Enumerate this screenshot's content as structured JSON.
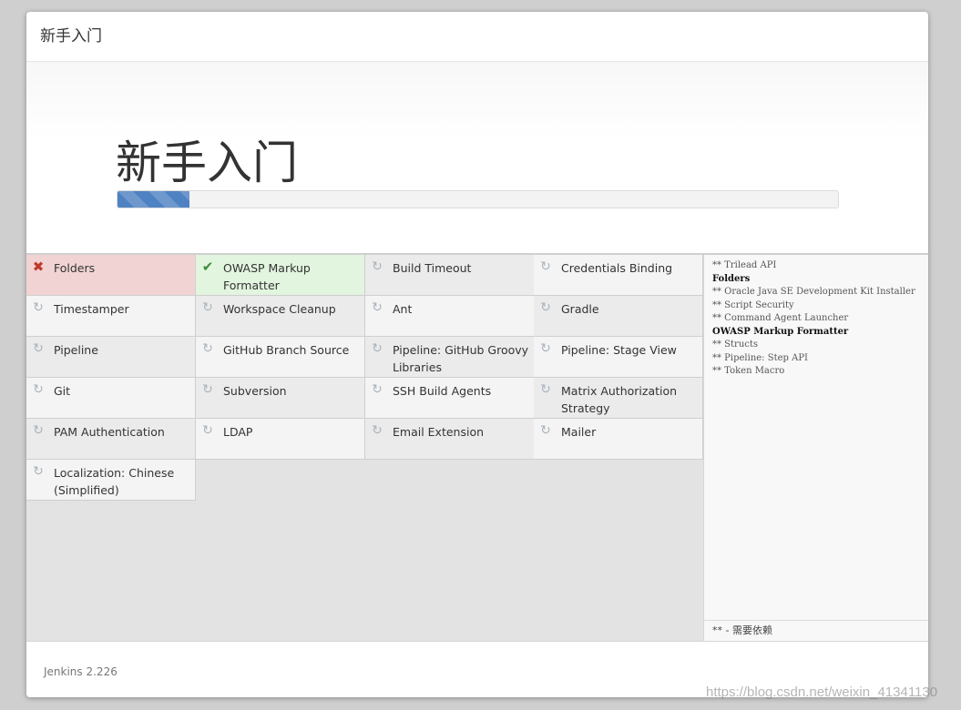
{
  "header": {
    "title": "新手入门"
  },
  "jumbotron": {
    "title": "新手入门",
    "progress_fraction": 0.1
  },
  "plugins": [
    {
      "name": "Folders",
      "status": "failed",
      "icon": "x-icon"
    },
    {
      "name": "OWASP Markup Formatter",
      "status": "success",
      "icon": "check-icon"
    },
    {
      "name": "Build Timeout",
      "status": "pending",
      "icon": "refresh-icon"
    },
    {
      "name": "Credentials Binding",
      "status": "pending",
      "icon": "refresh-icon"
    },
    {
      "name": "Timestamper",
      "status": "pending",
      "icon": "refresh-icon"
    },
    {
      "name": "Workspace Cleanup",
      "status": "pending",
      "icon": "refresh-icon"
    },
    {
      "name": "Ant",
      "status": "pending",
      "icon": "refresh-icon"
    },
    {
      "name": "Gradle",
      "status": "pending",
      "icon": "refresh-icon"
    },
    {
      "name": "Pipeline",
      "status": "pending",
      "icon": "refresh-icon"
    },
    {
      "name": "GitHub Branch Source",
      "status": "pending",
      "icon": "refresh-icon"
    },
    {
      "name": "Pipeline: GitHub Groovy Libraries",
      "status": "pending",
      "icon": "refresh-icon"
    },
    {
      "name": "Pipeline: Stage View",
      "status": "pending",
      "icon": "refresh-icon"
    },
    {
      "name": "Git",
      "status": "pending",
      "icon": "refresh-icon"
    },
    {
      "name": "Subversion",
      "status": "pending",
      "icon": "refresh-icon"
    },
    {
      "name": "SSH Build Agents",
      "status": "pending",
      "icon": "refresh-icon"
    },
    {
      "name": "Matrix Authorization Strategy",
      "status": "pending",
      "icon": "refresh-icon"
    },
    {
      "name": "PAM Authentication",
      "status": "pending",
      "icon": "refresh-icon"
    },
    {
      "name": "LDAP",
      "status": "pending",
      "icon": "refresh-icon"
    },
    {
      "name": "Email Extension",
      "status": "pending",
      "icon": "refresh-icon"
    },
    {
      "name": "Mailer",
      "status": "pending",
      "icon": "refresh-icon"
    },
    {
      "name": "Localization: Chinese (Simplified)",
      "status": "pending",
      "icon": "refresh-icon"
    }
  ],
  "log": [
    {
      "text": "** Trilead API",
      "kind": "dep"
    },
    {
      "text": "Folders",
      "kind": "main"
    },
    {
      "text": "** Oracle Java SE Development Kit Installer",
      "kind": "dep"
    },
    {
      "text": "** Script Security",
      "kind": "dep"
    },
    {
      "text": "** Command Agent Launcher",
      "kind": "dep"
    },
    {
      "text": "OWASP Markup Formatter",
      "kind": "main"
    },
    {
      "text": "** Structs",
      "kind": "dep"
    },
    {
      "text": "** Pipeline: Step API",
      "kind": "dep"
    },
    {
      "text": "** Token Macro",
      "kind": "dep"
    }
  ],
  "legend": "** - 需要依赖",
  "footer": {
    "version": "Jenkins 2.226"
  },
  "watermark": "https://blog.csdn.net/weixin_41341130",
  "colors": {
    "failed": "#f2d3d3",
    "success": "#e2f5de",
    "progress": "#4f82c2"
  }
}
